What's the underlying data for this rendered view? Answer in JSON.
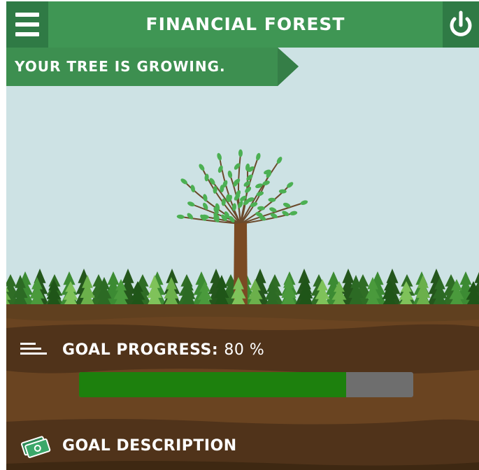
{
  "header": {
    "title": "FINANCIAL FOREST"
  },
  "banner": {
    "text": "YOUR TREE IS GROWING."
  },
  "goal": {
    "progress_label": "GOAL PROGRESS:",
    "progress_value": "80 %",
    "progress_fraction": 0.8,
    "description_label": "GOAL DESCRIPTION"
  },
  "icons": {
    "menu": "hamburger-icon",
    "power": "power-icon",
    "progress": "progress-lines-icon",
    "description": "money-icon"
  },
  "colors": {
    "header": "#3f9654",
    "header_dark": "#2f7a45",
    "sky": "#cde2e4",
    "soil": "#6a4421",
    "progress_fill": "#1d800d",
    "progress_track": "#6e6e6e"
  }
}
